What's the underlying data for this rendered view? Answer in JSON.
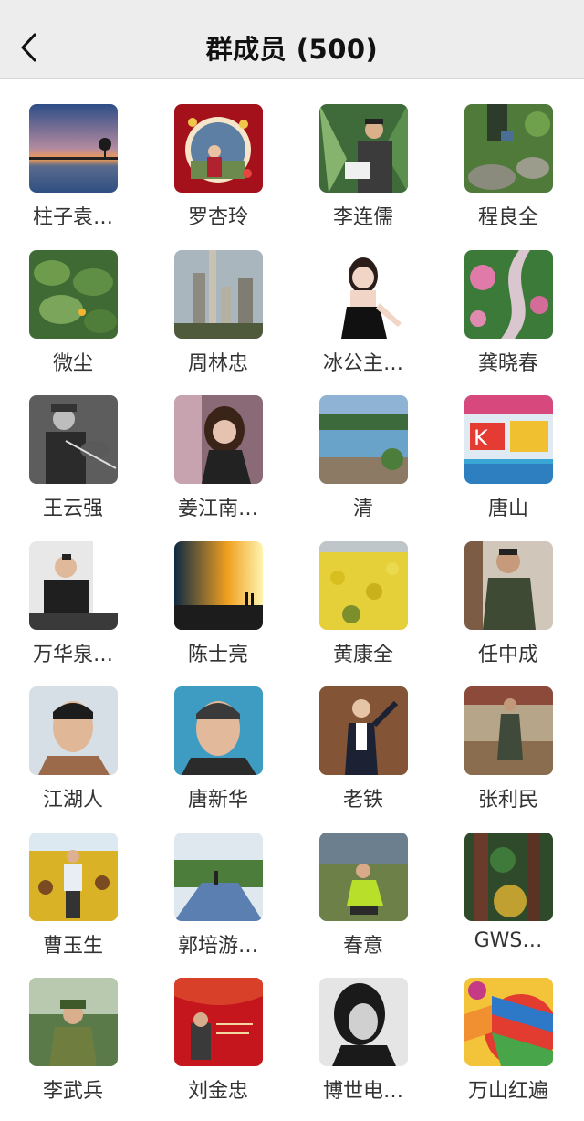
{
  "header": {
    "title": "群成员 (500)"
  },
  "members": [
    {
      "name": "柱子袁…",
      "avatar": "sunset-lake-photo"
    },
    {
      "name": "罗杏玲",
      "avatar": "woman-red-frame-photo"
    },
    {
      "name": "李连儒",
      "avatar": "man-in-forest-photo"
    },
    {
      "name": "程良全",
      "avatar": "garden-rocks-photo"
    },
    {
      "name": "微尘",
      "avatar": "green-leaves-photo"
    },
    {
      "name": "周林忠",
      "avatar": "city-skyscrapers-photo"
    },
    {
      "name": "冰公主…",
      "avatar": "woman-black-dress-photo"
    },
    {
      "name": "龚晓春",
      "avatar": "flower-garden-path-photo"
    },
    {
      "name": "王云强",
      "avatar": "soldier-violin-photo"
    },
    {
      "name": "姜江南…",
      "avatar": "woman-portrait-photo"
    },
    {
      "name": "清",
      "avatar": "river-landscape-photo"
    },
    {
      "name": "唐山",
      "avatar": "colorful-sign-photo"
    },
    {
      "name": "万华泉…",
      "avatar": "man-at-desk-photo"
    },
    {
      "name": "陈士亮",
      "avatar": "sunset-couple-photo"
    },
    {
      "name": "黄康全",
      "avatar": "rapeseed-field-photo"
    },
    {
      "name": "任中成",
      "avatar": "man-green-jacket-photo"
    },
    {
      "name": "江湖人",
      "avatar": "man-portrait-photo"
    },
    {
      "name": "唐新华",
      "avatar": "elder-man-portrait-photo"
    },
    {
      "name": "老铁",
      "avatar": "man-waving-photo"
    },
    {
      "name": "张利民",
      "avatar": "man-standing-field-photo"
    },
    {
      "name": "曹玉生",
      "avatar": "man-sunflowers-photo"
    },
    {
      "name": "郭培游…",
      "avatar": "park-path-photo"
    },
    {
      "name": "春意",
      "avatar": "woman-grassland-photo"
    },
    {
      "name": "GWS…",
      "avatar": "redwood-forest-photo"
    },
    {
      "name": "李武兵",
      "avatar": "soldier-portrait-photo"
    },
    {
      "name": "刘金忠",
      "avatar": "red-book-cover-photo"
    },
    {
      "name": "博世电…",
      "avatar": "woman-bw-portrait-photo"
    },
    {
      "name": "万山红遍",
      "avatar": "hot-air-balloon-photo"
    }
  ]
}
